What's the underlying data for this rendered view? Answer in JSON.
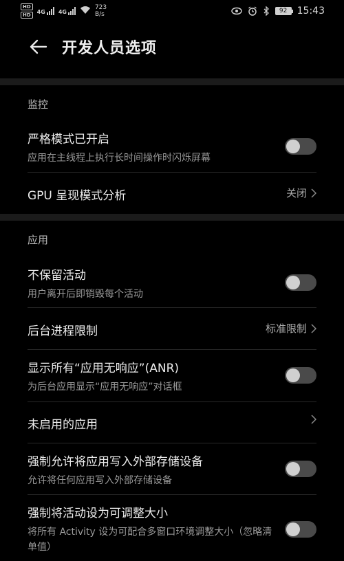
{
  "status_bar": {
    "hd1": "HD",
    "hd2": "HD",
    "sim1": "4G",
    "sim2": "4G",
    "speed_value": "723",
    "speed_unit": "B/s",
    "battery": "92",
    "time": "15:43"
  },
  "header": {
    "title": "开发人员选项"
  },
  "sections": [
    {
      "header": "监控",
      "items": [
        {
          "title": "严格模式已开启",
          "subtitle": "应用在主线程上执行长时间操作时闪烁屏幕",
          "toggle": false
        },
        {
          "title": "GPU 呈现模式分析",
          "value": "关闭"
        }
      ]
    },
    {
      "header": "应用",
      "items": [
        {
          "title": "不保留活动",
          "subtitle": "用户离开后即销毁每个活动",
          "toggle": false
        },
        {
          "title": "后台进程限制",
          "value": "标准限制"
        },
        {
          "title": "显示所有“应用无响应”(ANR)",
          "subtitle": "为后台应用显示“应用无响应”对话框",
          "toggle": false
        },
        {
          "title": "未启用的应用",
          "value": ""
        },
        {
          "title": "强制允许将应用写入外部存储设备",
          "subtitle": "允许将任何应用写入外部存储设备",
          "toggle": false
        },
        {
          "title": "强制将活动设为可调整大小",
          "subtitle": "将所有 Activity 设为可配合多窗口环境调整大小（忽略清单值）",
          "toggle": false
        }
      ]
    }
  ],
  "colors": {
    "background": "#000000",
    "divider": "#1b1b1b",
    "toggle_track_off": "#4a4a4a",
    "toggle_knob": "#d0d0d0"
  }
}
